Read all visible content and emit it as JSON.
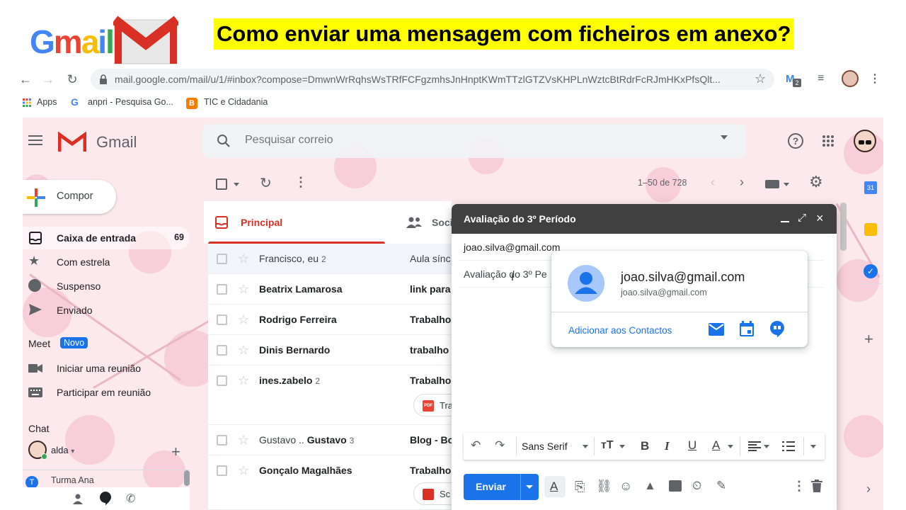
{
  "banner": {
    "logo_text": [
      "G",
      "m",
      "a",
      "i",
      "l"
    ],
    "headline": "Como enviar uma mensagem com ficheiros em anexo?"
  },
  "browser": {
    "url": "mail.google.com/mail/u/1/#inbox?compose=DmwnWrRqhsWsTRfFCFgzmhsJnHnptKWmTTzlGTZVsKHPLnWztcBtRdrFcRJmHKxPfsQlt...",
    "ext_badge": "2",
    "bookmarks": [
      "Apps",
      "anpri - Pesquisa Go...",
      "TIC e Cidadania"
    ]
  },
  "gmail": {
    "product_name": "Gmail",
    "search_placeholder": "Pesquisar correio",
    "compose_label": "Compor",
    "nav": [
      {
        "label": "Caixa de entrada",
        "count": "69"
      },
      {
        "label": "Com estrela",
        "count": ""
      },
      {
        "label": "Suspenso",
        "count": ""
      },
      {
        "label": "Enviado",
        "count": ""
      }
    ],
    "meet": {
      "title": "Meet",
      "badge": "Novo",
      "items": [
        "Iniciar uma reunião",
        "Participar em reunião"
      ]
    },
    "chat": {
      "title": "Chat",
      "user": "alda",
      "room": "Turma Ana"
    },
    "pagination": "1–50 de 728",
    "tabs": {
      "primary": "Principal",
      "social": "Soci"
    },
    "rows": [
      {
        "sender_pre": "Francisco, eu",
        "sender_bold": "",
        "count": "2",
        "subject": "Aula sínc",
        "subject_bold": false,
        "unread": false
      },
      {
        "sender_pre": "",
        "sender_bold": "Beatrix Lamarosa",
        "count": "",
        "subject": "link para",
        "subject_bold": true,
        "unread": true
      },
      {
        "sender_pre": "",
        "sender_bold": "Rodrigo Ferreira",
        "count": "",
        "subject": "Trabalho",
        "subject_bold": true,
        "unread": true
      },
      {
        "sender_pre": "",
        "sender_bold": "Dinis Bernardo",
        "count": "",
        "subject": "trabalho",
        "subject_bold": true,
        "unread": true
      },
      {
        "sender_pre": "",
        "sender_bold": "ines.zabelo",
        "count": "2",
        "subject": "Trabalho",
        "subject_bold": true,
        "unread": true
      },
      {
        "sender_pre": "Gustavo .. ",
        "sender_bold": "Gustavo",
        "count": "3",
        "subject": "Blog - Bo",
        "subject_bold": true,
        "unread": true
      },
      {
        "sender_pre": "",
        "sender_bold": "Gonçalo Magalhães",
        "count": "",
        "subject": "Trabalho",
        "subject_bold": true,
        "unread": true
      }
    ],
    "attachments": [
      "Tra",
      "Sc"
    ]
  },
  "compose": {
    "title": "Avaliação do 3º Período",
    "to": "joao.silva@gmail.com",
    "subject": "Avaliação do 3º Pe",
    "font": "Sans Serif",
    "send_label": "Enviar"
  },
  "contact_card": {
    "name": "joao.silva@gmail.com",
    "email": "joao.silva@gmail.com",
    "add_label": "Adicionar aos Contactos"
  },
  "colors": {
    "accent": "#1a73e8",
    "primary_tab": "#d93025",
    "compose_header": "#404040",
    "headline_bg": "#ffff00",
    "theme_bg": "#fbe9ee"
  }
}
